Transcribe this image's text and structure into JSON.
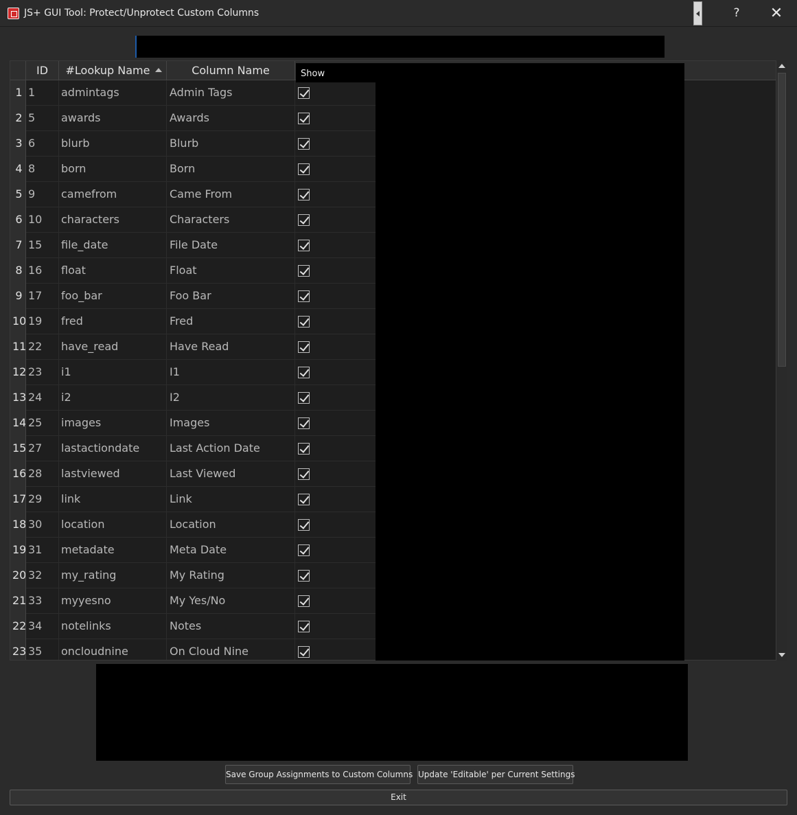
{
  "window": {
    "title": "JS+ GUI Tool: Protect/Unprotect Custom Columns",
    "help_label": "?",
    "close_label": "✕"
  },
  "table": {
    "headers": {
      "id": "ID",
      "lookup": "#Lookup Name",
      "column_name": "Column Name"
    },
    "show_tooltip": "Show",
    "rows": [
      {
        "num": "1",
        "id": "1",
        "lookup": "admintags",
        "name": "Admin Tags"
      },
      {
        "num": "2",
        "id": "5",
        "lookup": "awards",
        "name": "Awards"
      },
      {
        "num": "3",
        "id": "6",
        "lookup": "blurb",
        "name": "Blurb"
      },
      {
        "num": "4",
        "id": "8",
        "lookup": "born",
        "name": "Born"
      },
      {
        "num": "5",
        "id": "9",
        "lookup": "camefrom",
        "name": "Came From"
      },
      {
        "num": "6",
        "id": "10",
        "lookup": "characters",
        "name": "Characters"
      },
      {
        "num": "7",
        "id": "15",
        "lookup": "file_date",
        "name": "File Date"
      },
      {
        "num": "8",
        "id": "16",
        "lookup": "float",
        "name": "Float"
      },
      {
        "num": "9",
        "id": "17",
        "lookup": "foo_bar",
        "name": "Foo Bar"
      },
      {
        "num": "10",
        "id": "19",
        "lookup": "fred",
        "name": "Fred"
      },
      {
        "num": "11",
        "id": "22",
        "lookup": "have_read",
        "name": "Have Read"
      },
      {
        "num": "12",
        "id": "23",
        "lookup": "i1",
        "name": "I1"
      },
      {
        "num": "13",
        "id": "24",
        "lookup": "i2",
        "name": "I2"
      },
      {
        "num": "14",
        "id": "25",
        "lookup": "images",
        "name": "Images"
      },
      {
        "num": "15",
        "id": "27",
        "lookup": "lastactiondate",
        "name": "Last Action Date"
      },
      {
        "num": "16",
        "id": "28",
        "lookup": "lastviewed",
        "name": "Last Viewed"
      },
      {
        "num": "17",
        "id": "29",
        "lookup": "link",
        "name": "Link"
      },
      {
        "num": "18",
        "id": "30",
        "lookup": "location",
        "name": "Location"
      },
      {
        "num": "19",
        "id": "31",
        "lookup": "metadate",
        "name": "Meta Date"
      },
      {
        "num": "20",
        "id": "32",
        "lookup": "my_rating",
        "name": "My Rating"
      },
      {
        "num": "21",
        "id": "33",
        "lookup": "myyesno",
        "name": "My Yes/No"
      },
      {
        "num": "22",
        "id": "34",
        "lookup": "notelinks",
        "name": "Notes"
      },
      {
        "num": "23",
        "id": "35",
        "lookup": "oncloudnine",
        "name": "On Cloud Nine"
      }
    ]
  },
  "buttons": {
    "save": "Save Group Assignments to Custom Columns",
    "update": "Update 'Editable' per Current Settings",
    "exit": "Exit"
  }
}
